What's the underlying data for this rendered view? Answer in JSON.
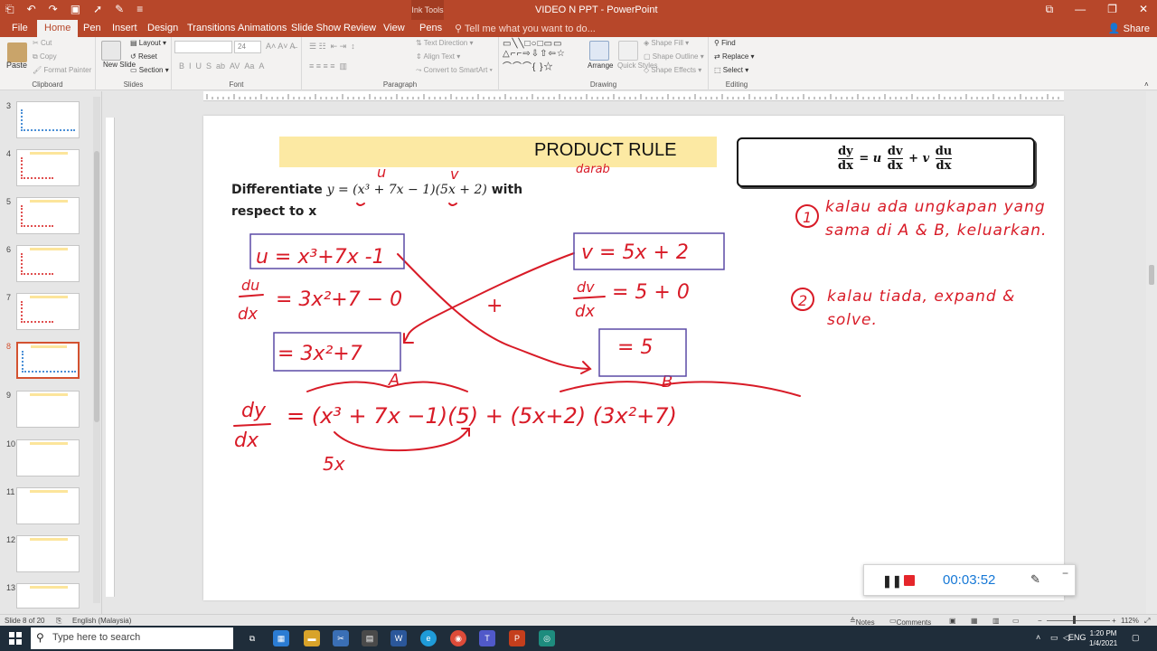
{
  "window": {
    "title": "VIDEO N PPT - PowerPoint",
    "context_tab": "Ink Tools"
  },
  "tabs": [
    "File",
    "Home",
    "Pen",
    "Insert",
    "Design",
    "Transitions",
    "Animations",
    "Slide Show",
    "Review",
    "View",
    "Pens"
  ],
  "active_tab": "Home",
  "tell_me": "Tell me what you want to do...",
  "share": "Share",
  "ribbon": {
    "clipboard": {
      "label": "Clipboard",
      "paste": "Paste",
      "cut": "Cut",
      "copy": "Copy",
      "format_painter": "Format Painter"
    },
    "slides": {
      "label": "Slides",
      "new_slide": "New Slide",
      "layout": "Layout",
      "reset": "Reset",
      "section": "Section"
    },
    "font": {
      "label": "Font",
      "size": "24"
    },
    "paragraph": {
      "label": "Paragraph",
      "text_direction": "Text Direction",
      "align_text": "Align Text",
      "convert": "Convert to SmartArt"
    },
    "drawing": {
      "label": "Drawing",
      "arrange": "Arrange",
      "quick_styles": "Quick Styles",
      "shape_fill": "Shape Fill",
      "shape_outline": "Shape Outline",
      "shape_effects": "Shape Effects"
    },
    "editing": {
      "label": "Editing",
      "find": "Find",
      "replace": "Replace",
      "select": "Select"
    }
  },
  "thumbnails": [
    {
      "num": "3"
    },
    {
      "num": "4"
    },
    {
      "num": "5"
    },
    {
      "num": "6"
    },
    {
      "num": "7"
    },
    {
      "num": "8",
      "active": true
    },
    {
      "num": "9"
    },
    {
      "num": "10"
    },
    {
      "num": "11"
    },
    {
      "num": "12"
    },
    {
      "num": "13"
    }
  ],
  "slide": {
    "title": "PRODUCT RULE",
    "formula": {
      "lhs_num": "dy",
      "lhs_den": "dx",
      "u": "u",
      "dv": "dv",
      "dx": "dx",
      "plus": "+",
      "v": "v",
      "du": "du"
    },
    "question_line1_pre": "Differentiate ",
    "question_math": "y = (x³ + 7x − 1)(5x + 2)",
    "question_line1_post": " with",
    "question_line2": "respect to x",
    "handwriting": {
      "u_mark": "u",
      "v_mark": "v",
      "note_top": "darab",
      "u_expr": "u = x³+7x -1",
      "du_lhs_num": "du",
      "du_lhs_den": "dx",
      "du_rhs": "= 3x²+7 − 0",
      "du_result": "= 3x²+7",
      "v_expr": "v = 5x + 2",
      "dv_lhs_num": "dv",
      "dv_lhs_den": "dx",
      "dv_rhs": "= 5 + 0",
      "dv_result": "= 5",
      "plus_mark": "+",
      "label_a": "A",
      "label_b": "B",
      "final_lhs_num": "dy",
      "final_lhs_den": "dx",
      "final_rhs": "= (x³ + 7x −1)(5) + (5x+2) (3x²+7)",
      "expand_hint": "5x",
      "note1_num": "1",
      "note1": "kalau ada ungkapan yang sama di A & B, keluarkan.",
      "note2_num": "2",
      "note2": "kalau tiada, expand & solve."
    }
  },
  "recorder": {
    "time": "00:03:52"
  },
  "status": {
    "slide_of": "Slide 8 of 20",
    "language": "English (Malaysia)",
    "notes": "Notes",
    "comments": "Comments",
    "zoom": "112%"
  },
  "taskbar": {
    "search_placeholder": "Type here to search",
    "lang": "ENG",
    "time": "1:20 PM",
    "date": "1/4/2021"
  },
  "colors": {
    "accent": "#b7472a",
    "ink": "#d81b27",
    "title_fill": "#fce9a3",
    "timer": "#1678d6"
  }
}
